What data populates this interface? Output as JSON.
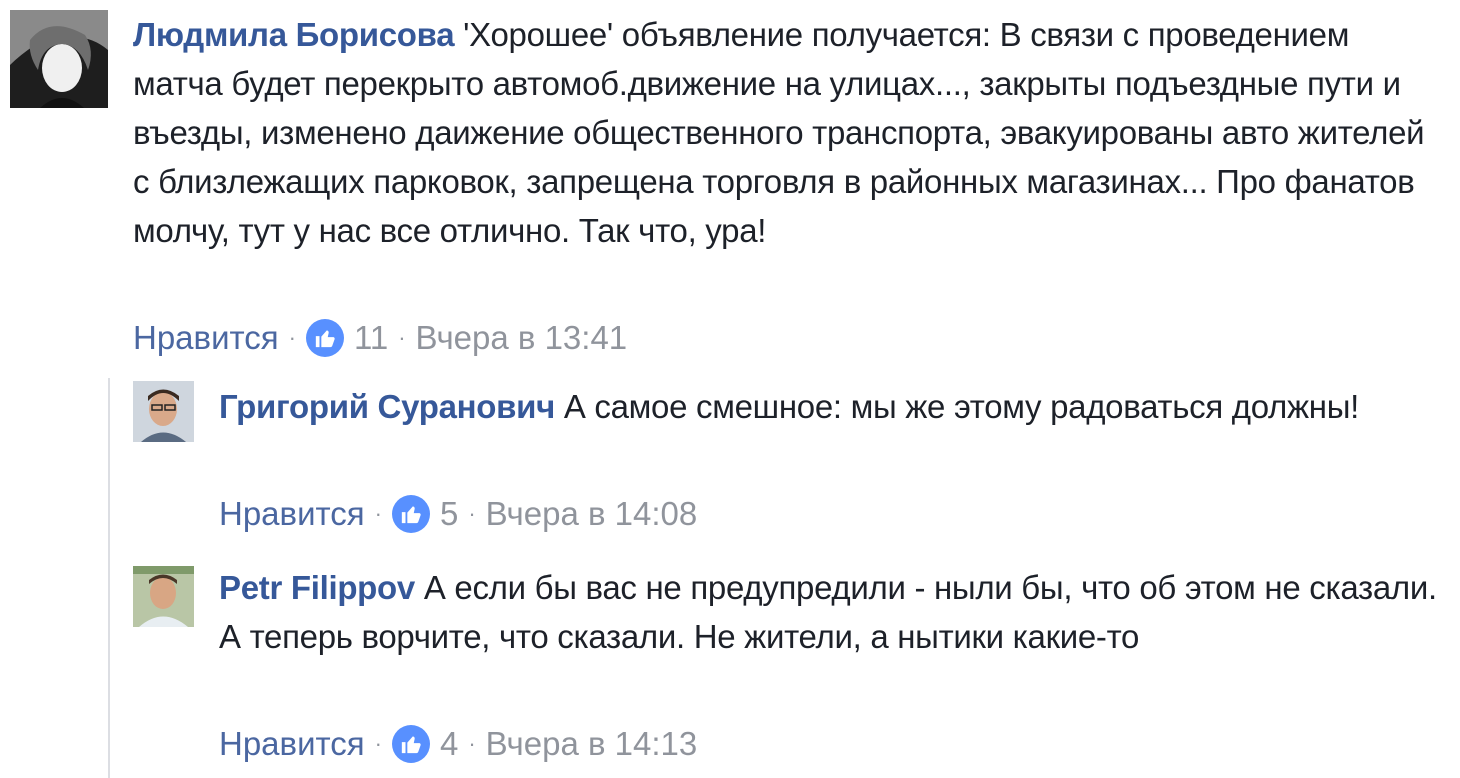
{
  "comments": [
    {
      "author": "Людмила Борисова",
      "text": "'Хорошее' объявление получается: В связи с проведением матча будет перекрыто автомоб.движение на улицах..., закрыты подъездные пути и въезды, изменено даижение общественного транспорта, эвакуированы авто жителей с близлежащих парковок, запрещена торговля в районных магазинах... Про фанатов молчу, тут у нас все отлично. Так что, ура!",
      "like_label": "Нравится",
      "like_count": "11",
      "time": "Вчера в 13:41"
    }
  ],
  "replies": [
    {
      "author": "Григорий Суранович",
      "text": "А самое смешное: мы же этому радоваться должны!",
      "like_label": "Нравится",
      "like_count": "5",
      "time": "Вчера в 14:08"
    },
    {
      "author": "Petr Filippov",
      "text": "А если бы вас не предупредили - ныли бы, что об этом не сказали. А теперь ворчите, что сказали. Не жители, а нытики какие-то",
      "like_label": "Нравится",
      "like_count": "4",
      "time": "Вчера в 14:13"
    }
  ],
  "colors": {
    "author": "#365899",
    "like_badge": "#5890ff",
    "meta": "#90949c"
  },
  "icons": {
    "like": "thumbs-up-icon"
  }
}
